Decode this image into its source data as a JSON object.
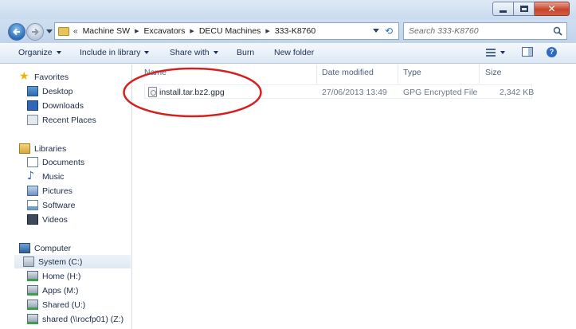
{
  "titlebar": {
    "buttons": {
      "minimize": "minimize-icon",
      "maximize": "maximize-icon",
      "close": "close-icon"
    }
  },
  "address": {
    "breadcrumbs": [
      "Machine SW",
      "Excavators",
      "DECU Machines",
      "333-K8760"
    ],
    "overflow": "«"
  },
  "search": {
    "placeholder": "Search 333-K8760"
  },
  "toolbar": {
    "organize": "Organize",
    "include_in_library": "Include in library",
    "share_with": "Share with",
    "burn": "Burn",
    "new_folder": "New folder"
  },
  "nav": {
    "favorites": {
      "label": "Favorites",
      "items": [
        "Desktop",
        "Downloads",
        "Recent Places"
      ]
    },
    "libraries": {
      "label": "Libraries",
      "items": [
        "Documents",
        "Music",
        "Pictures",
        "Software",
        "Videos"
      ]
    },
    "computer": {
      "label": "Computer",
      "items": [
        "System (C:)",
        "Home (H:)",
        "Apps (M:)",
        "Shared (U:)",
        "shared (\\\\rocfp01) (Z:)"
      ],
      "selected": "System (C:)"
    }
  },
  "columns": {
    "name": "Name",
    "date_modified": "Date modified",
    "type": "Type",
    "size": "Size"
  },
  "files": [
    {
      "name": "install.tar.bz2.gpg",
      "date_modified": "27/06/2013 13:49",
      "type": "GPG Encrypted File",
      "size": "2,342 KB"
    }
  ],
  "colors": {
    "annotation": "#d62020",
    "accent": "#2d6cc0"
  }
}
